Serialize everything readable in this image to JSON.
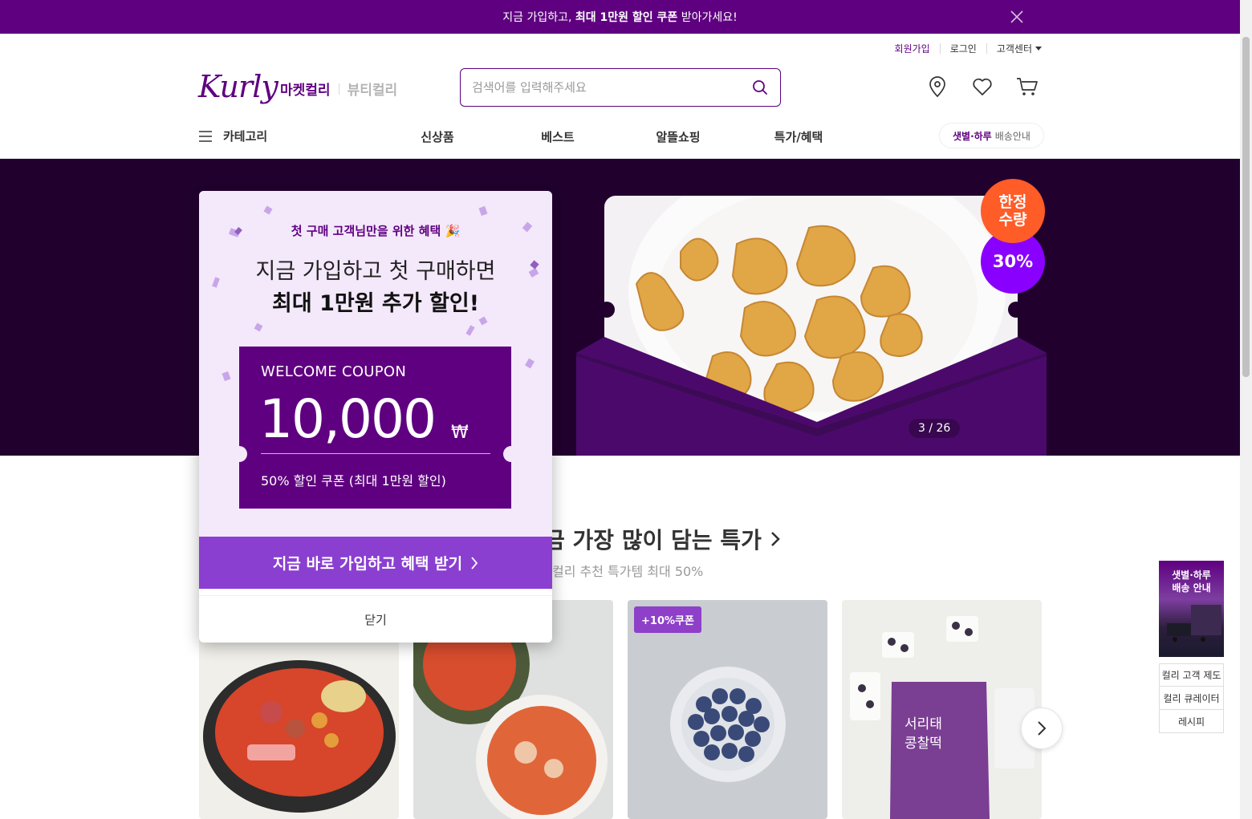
{
  "promo_bar": {
    "text_before": "지금 가입하고, ",
    "text_bold": "최대 1만원 할인 쿠폰",
    "text_after": " 받아가세요!"
  },
  "user_menu": {
    "signup": "회원가입",
    "login": "로그인",
    "customer_center": "고객센터"
  },
  "brand": {
    "logo": "Kurly",
    "market": "마켓컬리",
    "beauty": "뷰티컬리"
  },
  "search": {
    "placeholder": "검색어를 입력해주세요"
  },
  "nav": {
    "category": "카테고리",
    "items": [
      "신상품",
      "베스트",
      "알뜰쇼핑",
      "특가/혜택"
    ],
    "delivery_bold": "샛별·하루",
    "delivery_rest": "배송안내"
  },
  "hero": {
    "badge_limited": "한정\n수량",
    "badge_discount": "30%",
    "pager": "3 / 26"
  },
  "section": {
    "title": "금 가장 많이 담는 특가",
    "subtitle": "컬리 추천 특가템 최대 50%"
  },
  "products": [
    {
      "coupon": ""
    },
    {
      "coupon": ""
    },
    {
      "coupon": "+10%쿠폰"
    },
    {
      "coupon": ""
    }
  ],
  "side_banner": {
    "title": "샛별·하루\n배송 안내",
    "links": [
      "컬리 고객 제도",
      "컬리 큐레이터",
      "레시피"
    ]
  },
  "popup": {
    "eyebrow": "첫 구매 고객님만을 위한 혜택 🎉",
    "headline1": "지금 가입하고 첫 구매하면",
    "headline2": "최대 1만원 추가 할인!",
    "coupon_label": "WELCOME COUPON",
    "coupon_amount": "10,000",
    "coupon_currency": "₩",
    "coupon_desc": "50% 할인 쿠폰 (최대 1만원 할인)",
    "cta": "지금 바로 가입하고 혜택 받기",
    "close": "닫기"
  },
  "colors": {
    "brand_purple": "#5f0080",
    "cta_purple": "#8a3fd1",
    "hero_bg": "#21002e",
    "badge_orange": "#ff5c28",
    "badge_violet": "#8a00ff"
  }
}
